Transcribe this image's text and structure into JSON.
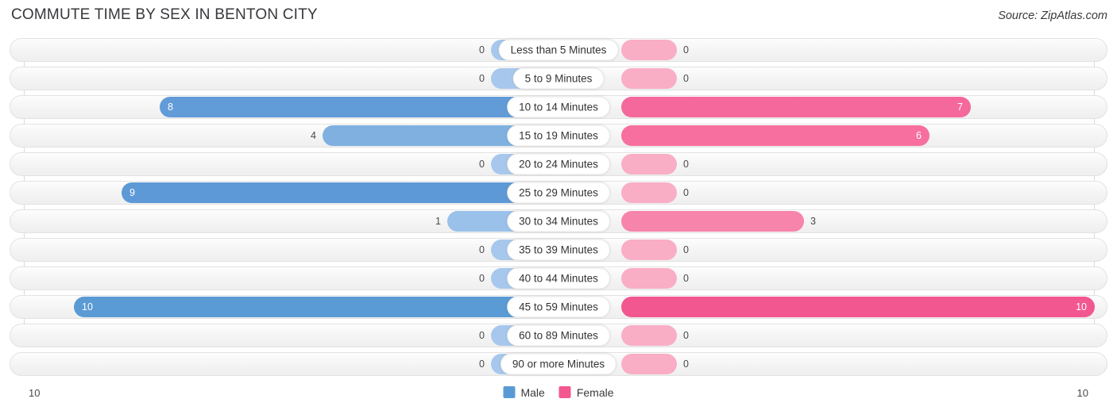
{
  "header": {
    "title": "COMMUTE TIME BY SEX IN BENTON CITY",
    "source": "Source: ZipAtlas.com"
  },
  "legend": {
    "male_label": "Male",
    "female_label": "Female",
    "male_color": "#5b9bd5",
    "female_color": "#f2578f"
  },
  "axis": {
    "left_end": "10",
    "right_end": "10"
  },
  "chart_data": {
    "type": "bar",
    "orientation": "horizontal",
    "subtype": "diverging-bidirectional",
    "title": "COMMUTE TIME BY SEX IN BENTON CITY",
    "xlabel": "",
    "ylabel": "",
    "xlim": [
      10,
      0,
      10
    ],
    "grid": false,
    "legend_position": "bottom-center",
    "categories": [
      "Less than 5 Minutes",
      "5 to 9 Minutes",
      "10 to 14 Minutes",
      "15 to 19 Minutes",
      "20 to 24 Minutes",
      "25 to 29 Minutes",
      "30 to 34 Minutes",
      "35 to 39 Minutes",
      "40 to 44 Minutes",
      "45 to 59 Minutes",
      "60 to 89 Minutes",
      "90 or more Minutes"
    ],
    "series": [
      {
        "name": "Male",
        "values": [
          0,
          0,
          8,
          4,
          0,
          9,
          1,
          0,
          0,
          10,
          0,
          0
        ]
      },
      {
        "name": "Female",
        "values": [
          0,
          0,
          7,
          6,
          0,
          0,
          3,
          0,
          0,
          10,
          0,
          0
        ]
      }
    ]
  },
  "rows": [
    {
      "label": "Less than 5 Minutes",
      "male": "0",
      "female": "0",
      "male_w": 70,
      "female_w": 70,
      "male_inside": false,
      "female_inside": false,
      "male_color": "#a7c8ec",
      "female_color": "#f9aec6"
    },
    {
      "label": "5 to 9 Minutes",
      "male": "0",
      "female": "0",
      "male_w": 70,
      "female_w": 70,
      "male_inside": false,
      "female_inside": false,
      "male_color": "#a7c8ec",
      "female_color": "#f9aec6"
    },
    {
      "label": "10 to 14 Minutes",
      "male": "8",
      "female": "7",
      "male_w": 487,
      "female_w": 440,
      "male_inside": true,
      "female_inside": true,
      "male_color": "#619bd8",
      "female_color": "#f4689b"
    },
    {
      "label": "15 to 19 Minutes",
      "male": "4",
      "female": "6",
      "male_w": 282,
      "female_w": 388,
      "male_inside": false,
      "female_inside": true,
      "male_color": "#7fb0e0",
      "female_color": "#f66f9f"
    },
    {
      "label": "20 to 24 Minutes",
      "male": "0",
      "female": "0",
      "male_w": 70,
      "female_w": 70,
      "male_inside": false,
      "female_inside": false,
      "male_color": "#a7c8ec",
      "female_color": "#f9aec6"
    },
    {
      "label": "25 to 29 Minutes",
      "male": "9",
      "female": "0",
      "male_w": 535,
      "female_w": 70,
      "male_inside": true,
      "female_inside": false,
      "male_color": "#5e99d7",
      "female_color": "#f9aec6"
    },
    {
      "label": "30 to 34 Minutes",
      "male": "1",
      "female": "3",
      "male_w": 125,
      "female_w": 230,
      "male_inside": false,
      "female_inside": false,
      "male_color": "#9ac1ea",
      "female_color": "#f784aa"
    },
    {
      "label": "35 to 39 Minutes",
      "male": "0",
      "female": "0",
      "male_w": 70,
      "female_w": 70,
      "male_inside": false,
      "female_inside": false,
      "male_color": "#a7c8ec",
      "female_color": "#f9aec6"
    },
    {
      "label": "40 to 44 Minutes",
      "male": "0",
      "female": "0",
      "male_w": 70,
      "female_w": 70,
      "male_inside": false,
      "female_inside": false,
      "male_color": "#a7c8ec",
      "female_color": "#f9aec6"
    },
    {
      "label": "45 to 59 Minutes",
      "male": "10",
      "female": "10",
      "male_w": 595,
      "female_w": 596,
      "male_inside": true,
      "female_inside": true,
      "male_color": "#5b9bd5",
      "female_color": "#f2578f"
    },
    {
      "label": "60 to 89 Minutes",
      "male": "0",
      "female": "0",
      "male_w": 70,
      "female_w": 70,
      "male_inside": false,
      "female_inside": false,
      "male_color": "#a7c8ec",
      "female_color": "#f9aec6"
    },
    {
      "label": "90 or more Minutes",
      "male": "0",
      "female": "0",
      "male_w": 70,
      "female_w": 70,
      "male_inside": false,
      "female_inside": false,
      "male_color": "#a7c8ec",
      "female_color": "#f9aec6"
    }
  ]
}
